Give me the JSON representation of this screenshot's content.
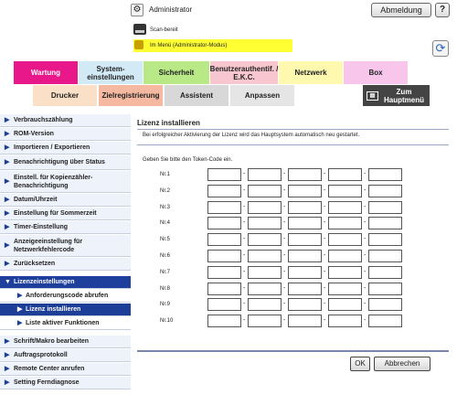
{
  "header": {
    "admin_label": "Administrator",
    "logout_label": "Abmeldung",
    "help_label": "?",
    "scan_status": "Scan-bereit",
    "mode_text": "Im Menü (Administrator-Modus)"
  },
  "main_tabs": [
    "Wartung",
    "System-\neinstellungen",
    "Sicherheit",
    "Benutzerauthentif. /\nE.K.C.",
    "Netzwerk",
    "Box"
  ],
  "sub_tabs": [
    "Drucker",
    "Zielregistrierung",
    "Assistent",
    "Anpassen"
  ],
  "home_tab": "Zum\nHauptmenü",
  "sidebar": {
    "items": [
      "Verbrauchszählung",
      "ROM-Version",
      "Importieren / Exportieren",
      "Benachrichtigung über Status",
      "Einstell. für Kopienzähler-\nBenachrichtigung",
      "Datum/Uhrzeit",
      "Einstellung für Sommerzeit",
      "Timer-Einstellung",
      "Anzeigeeinstellung für\nNetzwerkfehlercode",
      "Zurücksetzen",
      "Lizenzeinstellungen",
      "Anforderungscode abrufen",
      "Lizenz installieren",
      "Liste aktiver Funktionen",
      "Schrift/Makro bearbeiten",
      "Auftragsprotokoll",
      "Remote Center anrufen",
      "Setting Ferndiagnose"
    ]
  },
  "main": {
    "title": "Lizenz installieren",
    "description": "Bei erfolgreicher Aktivierung der Lizenz wird das Hauptsystem automatisch neu gestartet.",
    "prompt": "Geben Sie bitte den Token-Code ein.",
    "rows": [
      "Nr.1",
      "Nr.2",
      "Nr.3",
      "Nr.4",
      "Nr.5",
      "Nr.6",
      "Nr.7",
      "Nr.8",
      "Nr.9",
      "Nr.10"
    ],
    "separator": "-",
    "ok_label": "OK",
    "cancel_label": "Abbrechen"
  },
  "colors": {
    "maintenance_tab": "#e8178a",
    "system_tab": "#d2eaf6",
    "security_tab": "#b8e986",
    "auth_tab": "#f7c6cf",
    "network_tab": "#fff9b0",
    "box_tab": "#f8c6ea",
    "printer_tab": "#fbe0c8",
    "dest_tab": "#f4b9a0",
    "assistant_tab": "#d8d8d8",
    "customize_tab": "#e5e5e5",
    "home_tab": "#444444",
    "nav_active": "#1e3f9c",
    "mode_bar": "#ffff33"
  }
}
